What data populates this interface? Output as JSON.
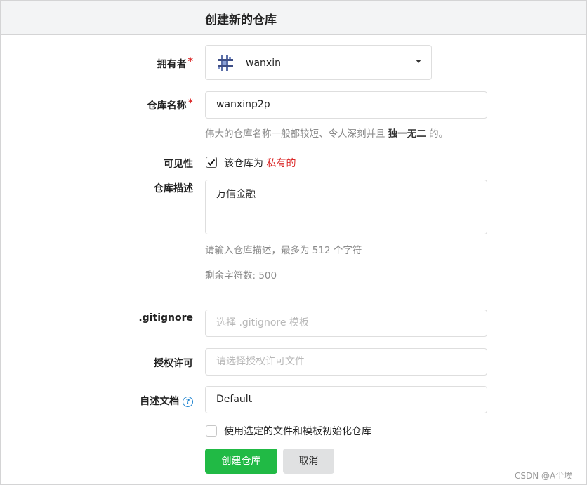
{
  "header": {
    "title": "创建新的仓库"
  },
  "owner": {
    "label": "拥有者",
    "required_mark": "*",
    "value": "wanxin"
  },
  "repo_name": {
    "label": "仓库名称",
    "required_mark": "*",
    "value": "wanxinp2p",
    "help_prefix": "伟大的仓库名称一般都较短、令人深刻并且",
    "help_emphasis": "独一无二",
    "help_suffix": "的。"
  },
  "visibility": {
    "label": "可见性",
    "checkbox_text": "该仓库为",
    "private_text": "私有的",
    "checked": true
  },
  "description": {
    "label": "仓库描述",
    "value": "万信金融",
    "help": "请输入仓库描述，最多为 512 个字符",
    "remaining": "剩余字符数: 500"
  },
  "gitignore": {
    "label": ".gitignore",
    "placeholder": "选择 .gitignore 模板"
  },
  "license": {
    "label": "授权许可",
    "placeholder": "请选择授权许可文件"
  },
  "readme": {
    "label": "自述文档",
    "value": "Default"
  },
  "init": {
    "label": "使用选定的文件和模板初始化仓库",
    "checked": false
  },
  "actions": {
    "create_label": "创建仓库",
    "cancel_label": "取消"
  },
  "watermark": "CSDN @A尘埃",
  "colors": {
    "primary": "#21ba45",
    "danger": "#db2828",
    "help_text": "#8a8a8a",
    "header_bg": "#f3f4f5"
  }
}
